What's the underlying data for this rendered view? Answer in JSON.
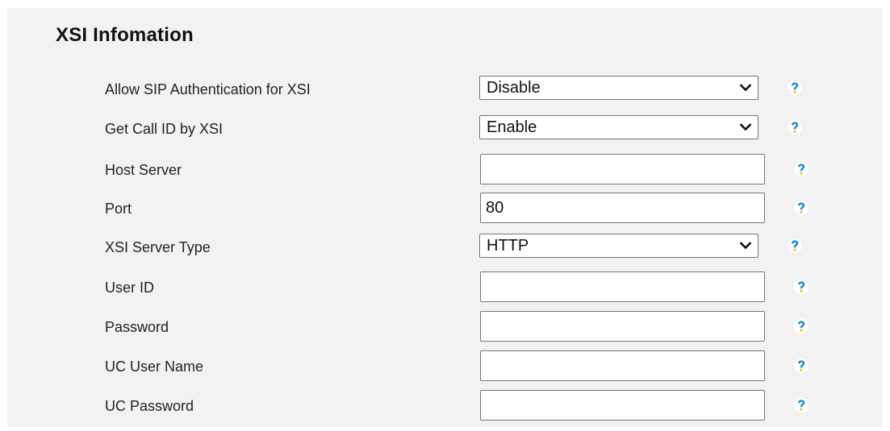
{
  "section": {
    "title": "XSI Infomation"
  },
  "help_icon": "help-question-icon",
  "colors": {
    "panel_background": "#f2f2f2",
    "help_icon_blue": "#1a8fd8",
    "help_icon_yellow": "#f2c21b"
  },
  "fields": {
    "allow_sip_auth": {
      "label": "Allow SIP Authentication for XSI",
      "type": "select",
      "value": "Disable"
    },
    "get_call_id": {
      "label": "Get Call ID by XSI",
      "type": "select",
      "value": "Enable"
    },
    "host_server": {
      "label": "Host Server",
      "type": "text",
      "value": ""
    },
    "port": {
      "label": "Port",
      "type": "text",
      "value": "80"
    },
    "xsi_server_type": {
      "label": "XSI Server Type",
      "type": "select",
      "value": "HTTP"
    },
    "user_id": {
      "label": "User ID",
      "type": "text",
      "value": ""
    },
    "password": {
      "label": "Password",
      "type": "password",
      "value": ""
    },
    "uc_user_name": {
      "label": "UC User Name",
      "type": "text",
      "value": ""
    },
    "uc_password": {
      "label": "UC Password",
      "type": "password",
      "value": ""
    }
  }
}
